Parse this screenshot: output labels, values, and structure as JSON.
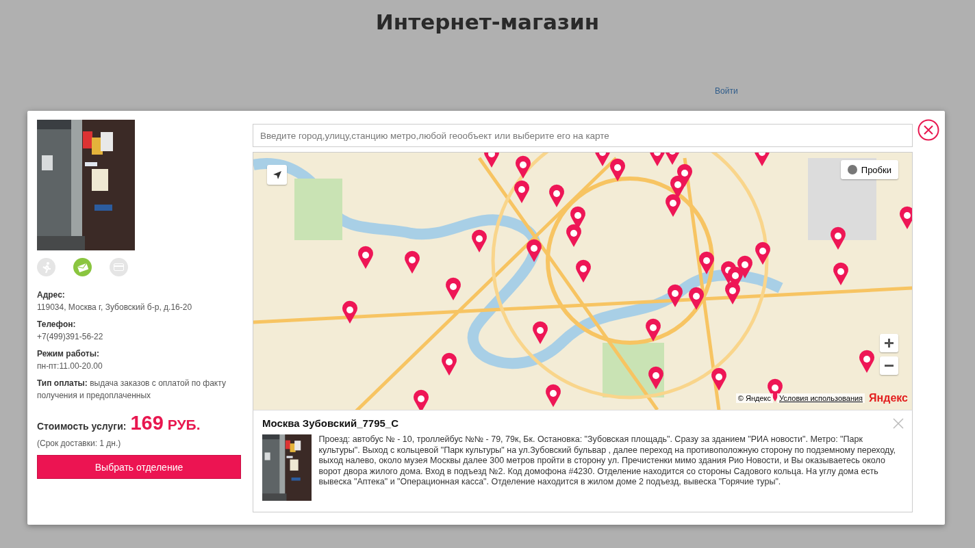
{
  "page": {
    "title": "Интернет-магазин",
    "login_link": "Войти"
  },
  "modal": {
    "delivery_options": [
      {
        "kind": "walk",
        "selected": false
      },
      {
        "kind": "envelope",
        "selected": true
      },
      {
        "kind": "card",
        "selected": false
      }
    ],
    "details": [
      {
        "label": "Адрес:",
        "value": "119034, Москва г, Зубовский б-р, д.16-20",
        "kind": "stacked"
      },
      {
        "label": "Телефон:",
        "value": "+7(499)391-56-22",
        "kind": "stacked"
      },
      {
        "label": "Режим работы:",
        "value": "пн-пт:11.00-20.00",
        "kind": "stacked"
      },
      {
        "label": "Тип оплаты:",
        "value": "выдача заказов с оплатой по факту получения и предоплаченных",
        "kind": "inline"
      }
    ],
    "price_label": "Стоимость услуги:",
    "price": "169",
    "currency": "РУБ.",
    "delivery_time": "(Срок доставки: 1 дн.)",
    "select_button": "Выбрать отделение",
    "search": {
      "placeholder": "Введите город,улицу,станцию метро,любой геообъект или выберите его на карте"
    },
    "map": {
      "traffic_button": "Пробки",
      "copyright": "© Яндекс",
      "terms_link": "Условия использования",
      "logo": "Яндекс"
    },
    "office": {
      "title": "Москва Зубовский_7795_С",
      "description": "Проезд: автобус № - 10, троллейбус №№ - 79, 79к, Бк. Остановка: \"Зубовская площадь\". Сразу за зданием \"РИА новости\". Метро: \"Парк культуры\". Выход с кольцевой \"Парк культуры\" на ул.Зубовский бульвар , далее переход на противоположную сторону по подземному переходу, выход налево, около музея Москвы далее 300 метров пройти в сторону ул. Пречистенки мимо здания Рио Новости, и Вы оказываетесь около ворот двора жилого дома. Вход в подъезд №2. Код домофона #4230. Отделение находится со стороны Садового кольца. На углу дома есть вывеска \"Аптека\" и \"Операционная касса\". Отделение находится в жилом доме 2 подъезд, вывеска \"Горячие туры\"."
    }
  }
}
